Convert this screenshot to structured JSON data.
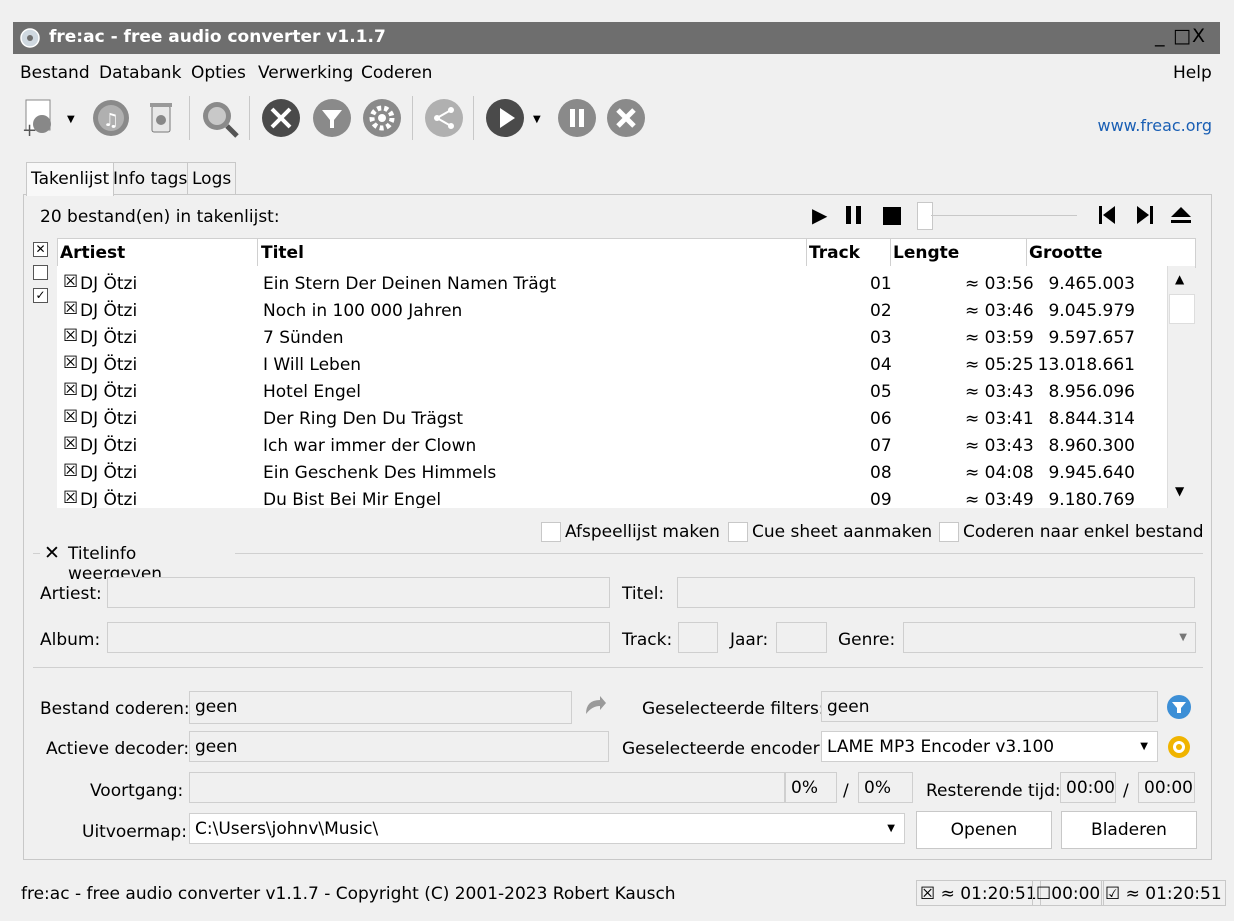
{
  "window": {
    "title": "fre:ac - free audio converter v1.1.7",
    "controls": {
      "minimize": "_",
      "maximize": "□",
      "close": "X"
    }
  },
  "menu": {
    "items": [
      "Bestand",
      "Databank",
      "Opties",
      "Verwerking",
      "Coderen"
    ],
    "help": "Help"
  },
  "toolbar": {
    "icons": [
      "add-files-icon",
      "add-audio-cd-icon",
      "remove-icon",
      "cddb-query-icon",
      "settings-icon",
      "filters-icon",
      "encoder-settings-icon",
      "share-icon",
      "start-encoding-icon",
      "pause-icon",
      "stop-icon"
    ],
    "link": "www.freac.org"
  },
  "tabs": [
    "Takenlijst",
    "Info tags",
    "Logs"
  ],
  "joblist": {
    "count_text": "20 bestand(en) in takenlijst:",
    "headers": {
      "artist": "Artiest",
      "title": "Titel",
      "track": "Track",
      "length": "Lengte",
      "size": "Grootte"
    },
    "rows": [
      {
        "artist": "DJ Ötzi",
        "title": "Ein Stern Der Deinen Namen Trägt",
        "track": "01",
        "length": "≈ 03:56",
        "size": "9.465.003"
      },
      {
        "artist": "DJ Ötzi",
        "title": "Noch in 100 000 Jahren",
        "track": "02",
        "length": "≈ 03:46",
        "size": "9.045.979"
      },
      {
        "artist": "DJ Ötzi",
        "title": "7 Sünden",
        "track": "03",
        "length": "≈ 03:59",
        "size": "9.597.657"
      },
      {
        "artist": "DJ Ötzi",
        "title": "I Will Leben",
        "track": "04",
        "length": "≈ 05:25",
        "size": "13.018.661"
      },
      {
        "artist": "DJ Ötzi",
        "title": "Hotel Engel",
        "track": "05",
        "length": "≈ 03:43",
        "size": "8.956.096"
      },
      {
        "artist": "DJ Ötzi",
        "title": "Der Ring Den Du Trägst",
        "track": "06",
        "length": "≈ 03:41",
        "size": "8.844.314"
      },
      {
        "artist": "DJ Ötzi",
        "title": "Ich war immer der Clown",
        "track": "07",
        "length": "≈ 03:43",
        "size": "8.960.300"
      },
      {
        "artist": "DJ Ötzi",
        "title": "Ein Geschenk Des Himmels",
        "track": "08",
        "length": "≈ 04:08",
        "size": "9.945.640"
      },
      {
        "artist": "DJ Ötzi",
        "title": "Du Bist Bei Mir Engel",
        "track": "09",
        "length": "≈ 03:49",
        "size": "9.180.769"
      }
    ],
    "options": {
      "playlist": "Afspeellijst maken",
      "cuesheet": "Cue sheet aanmaken",
      "single_file": "Coderen naar enkel bestand"
    }
  },
  "titleinfo": {
    "toggle_label": "Titelinfo weergeven",
    "artist_label": "Artiest:",
    "title_label": "Titel:",
    "album_label": "Album:",
    "track_label": "Track:",
    "year_label": "Jaar:",
    "genre_label": "Genre:"
  },
  "encoding": {
    "file_label": "Bestand coderen:",
    "file_value": "geen",
    "decoder_label": "Actieve decoder:",
    "decoder_value": "geen",
    "filters_label": "Geselecteerde filters:",
    "filters_value": "geen",
    "encoder_label": "Geselecteerde encoder:",
    "encoder_value": "LAME MP3 Encoder v3.100",
    "progress_label": "Voortgang:",
    "progress_file_pct": "0%",
    "progress_sep": "/",
    "progress_total_pct": "0%",
    "remaining_label": "Resterende tijd:",
    "remaining_file": "00:00",
    "remaining_total": "00:00",
    "output_label": "Uitvoermap:",
    "output_value": "C:\\Users\\johnv\\Music\\",
    "open_button": "Openen",
    "browse_button": "Bladeren"
  },
  "status": {
    "text": "fre:ac - free audio converter v1.1.7 - Copyright (C) 2001-2023 Robert Kausch",
    "total_all": "≈ 01:20:51",
    "total_unchecked": "00:00",
    "total_checked": "≈ 01:20:51"
  },
  "colors": {
    "titlebar": "#6e6e6e",
    "link": "#1a5fb4",
    "accent_blue": "#3d8fd6",
    "accent_orange": "#f0b400"
  }
}
